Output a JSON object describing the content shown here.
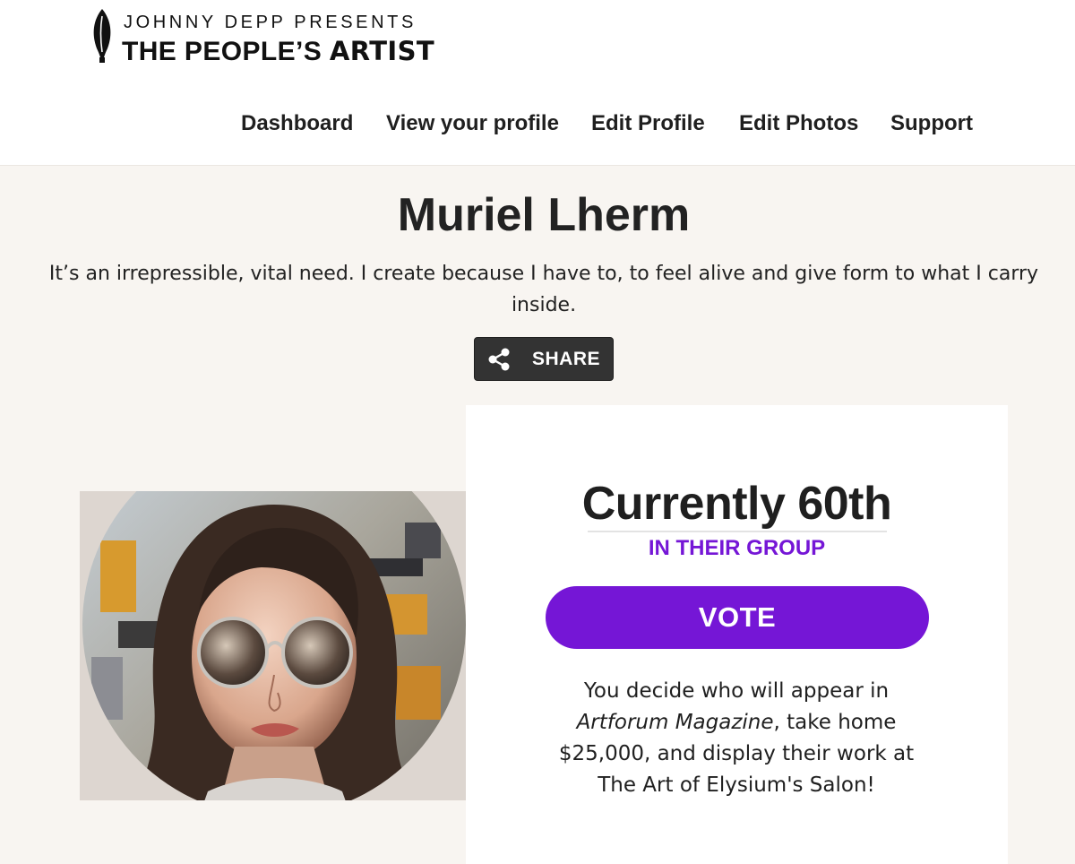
{
  "brand": {
    "presents": "JOHNNY DEPP PRESENTS",
    "title_prefix": "THE PEOPLE’S ",
    "title_strong": "ARTIST"
  },
  "nav": {
    "items": [
      {
        "label": "Dashboard"
      },
      {
        "label": "View your profile"
      },
      {
        "label": "Edit Profile"
      },
      {
        "label": "Edit Photos"
      },
      {
        "label": "Support"
      }
    ]
  },
  "profile": {
    "name": "Muriel Lherm",
    "bio": "It’s an irrepressible, vital need. I create because I have to, to feel alive and give form to what I carry inside.",
    "share_label": "SHARE"
  },
  "vote": {
    "rank": "Currently 60th",
    "group_label": "IN THEIR GROUP",
    "button_label": "VOTE",
    "promo_before": "You decide who will appear in ",
    "promo_italic": "Artforum Magazine",
    "promo_after": ", take home $25,000, and display their work at The Art of Elysium's Salon!"
  },
  "colors": {
    "accent": "#7516d6",
    "page_bg": "#f8f5f1",
    "share_bg": "#333333"
  },
  "icons": {
    "brand": "quill-leaf-icon",
    "share": "share-icon"
  }
}
